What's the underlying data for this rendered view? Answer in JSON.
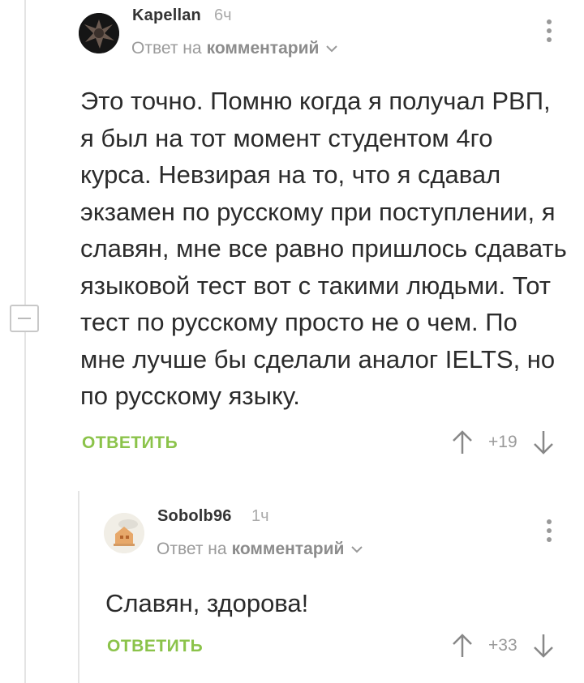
{
  "comments": [
    {
      "username": "Kapellan",
      "time": "6ч",
      "reply_prefix": "Ответ на",
      "reply_link": "комментарий",
      "text": "Это точно. Помню когда я получал РВП, я был на тот момент студентом 4го курса. Невзирая на то, что я сдавал экзамен по русскому при поступлении, я славян, мне все равно пришлось сдавать языковой тест вот с такими людьми. Тот тест по русскому просто не о чем. По мне лучше бы сделали аналог IELTS, но по русскому языку.",
      "reply_label": "ОТВЕТИТЬ",
      "rating": "+19"
    },
    {
      "username": "Sobolb96",
      "time": "1ч",
      "reply_prefix": "Ответ на",
      "reply_link": "комментарий",
      "text": "Славян, здорова!",
      "reply_label": "ОТВЕТИТЬ",
      "rating": "+33"
    }
  ],
  "colors": {
    "accent_green": "#8bc34a",
    "muted": "#9a9a9a",
    "thread_line": "#e4e4e4"
  }
}
